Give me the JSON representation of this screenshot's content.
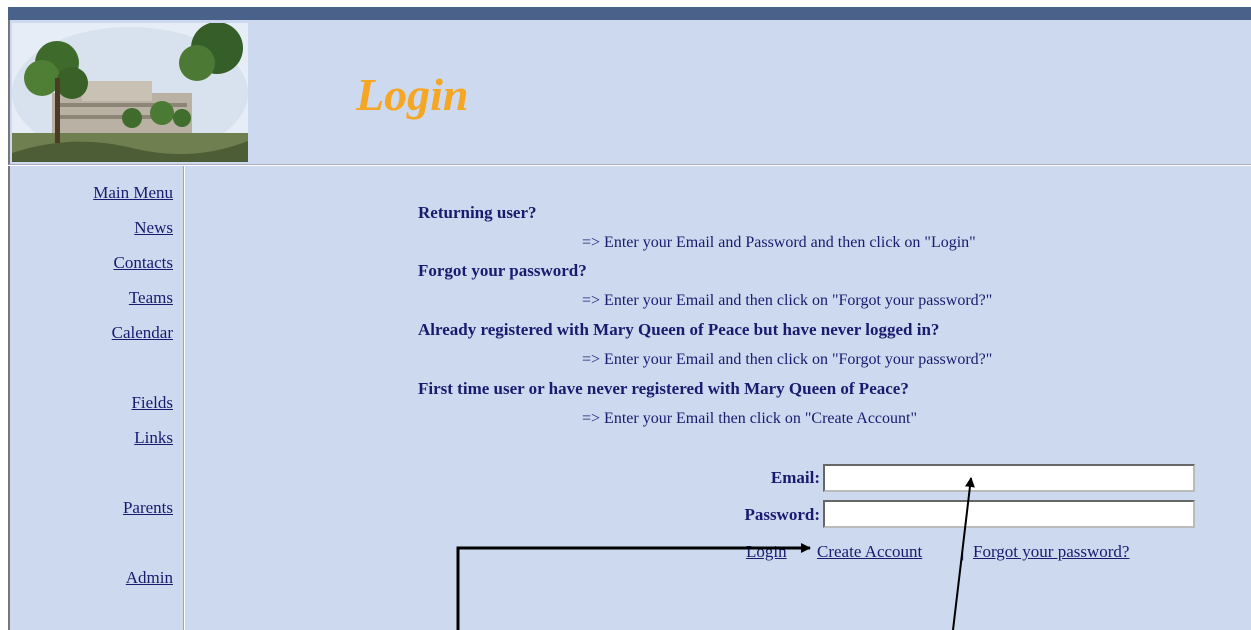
{
  "header": {
    "title": "Login"
  },
  "sidebar": {
    "items": [
      {
        "label": "Main Menu"
      },
      {
        "label": "News"
      },
      {
        "label": "Contacts"
      },
      {
        "label": "Teams"
      },
      {
        "label": "Calendar"
      },
      {
        "label": "Fields"
      },
      {
        "label": "Links"
      },
      {
        "label": "Parents"
      },
      {
        "label": "Admin"
      }
    ]
  },
  "instructions": [
    {
      "question": "Returning user?",
      "answer": "=> Enter your Email and Password and then click on \"Login\""
    },
    {
      "question": "Forgot your password?",
      "answer": "=> Enter your Email and then click on \"Forgot your password?\""
    },
    {
      "question": "Already registered with Mary Queen of Peace but have never logged in?",
      "answer": "=> Enter your Email and then click on \"Forgot your password?\""
    },
    {
      "question": "First time user or have never registered with Mary Queen of Peace?",
      "answer": "=> Enter your Email then click on \"Create Account\""
    }
  ],
  "form": {
    "email_label": "Email:",
    "email_value": "",
    "password_label": "Password:",
    "password_value": ""
  },
  "actions": {
    "login": "Login",
    "create_account": "Create Account",
    "separator": "|",
    "forgot_password": "Forgot your password?"
  },
  "colors": {
    "title": "#f5a623",
    "background": "#cdd9ef",
    "topbar": "#4a6189",
    "text": "#1a1a6e"
  }
}
